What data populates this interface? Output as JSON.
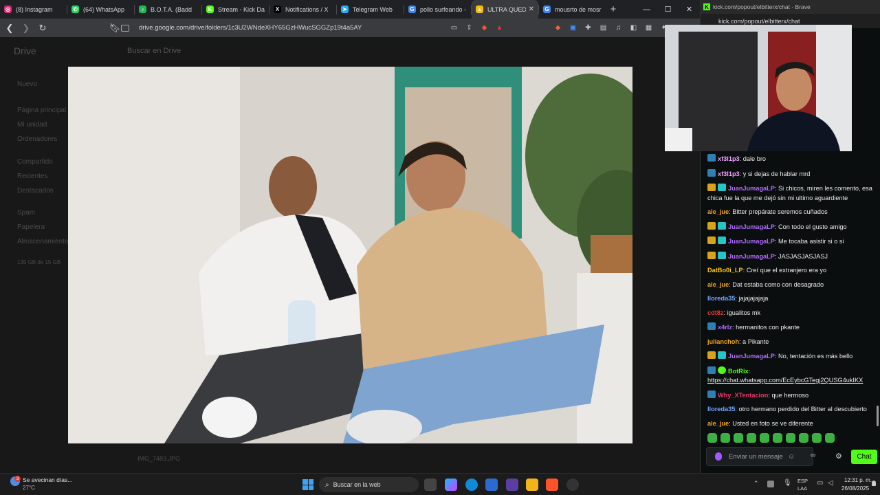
{
  "browser": {
    "tabs": [
      {
        "label": "(8) Instagram",
        "color": "#d62976",
        "glyph": "◎"
      },
      {
        "label": "(64) WhatsApp",
        "color": "#25d366",
        "glyph": "✆"
      },
      {
        "label": "B.O.T.A. (Badd",
        "color": "#1db954",
        "glyph": "♪"
      },
      {
        "label": "Stream - Kick Das",
        "color": "#53fc18",
        "glyph": "K"
      },
      {
        "label": "Notifications / X",
        "color": "#000000",
        "glyph": "X"
      },
      {
        "label": "Telegram Web",
        "color": "#2aabee",
        "glyph": "➤"
      },
      {
        "label": "pollo surfeando -",
        "color": "#4285f4",
        "glyph": "G"
      },
      {
        "label": "ULTRA QUED",
        "color": "#fbbc04",
        "glyph": "▲"
      },
      {
        "label": "mousrto de mosr",
        "color": "#4285f4",
        "glyph": "G"
      }
    ],
    "url": "drive.google.com/drive/folders/1c3U2WNdeXHY65GzHWucSGGZp19t4a5AY"
  },
  "drive": {
    "app_name": "Drive",
    "search_placeholder": "Buscar en Drive",
    "new_button": "Nuevo",
    "sidebar": [
      "Página principal",
      "Mi unidad",
      "Ordenadores",
      "Compartido",
      "Recientes",
      "Destacados",
      "Spam",
      "Papelera",
      "Almacenamiento"
    ],
    "storage": "135 GB de 15 GB",
    "file_row": "IMG_7483.JPG"
  },
  "kick": {
    "window_title": "kick.com/popout/elbitterx/chat - Brave",
    "url": "kick.com/popout/elbitterx/chat",
    "messages": [
      {
        "user": "xf3l1p3",
        "color": "#f2a4ff",
        "badges": [
          "kick"
        ],
        "text": "dale bro"
      },
      {
        "user": "xf3l1p3",
        "color": "#f2a4ff",
        "badges": [
          "kick"
        ],
        "text": "y si dejas de hablar mrd"
      },
      {
        "user": "JuanJumagaLP",
        "color": "#b36bff",
        "badges": [
          "crown",
          "sub"
        ],
        "text": "Si chicos, miren les comento, esa chica fue la que me dejó sin mi ultimo aguardiente"
      },
      {
        "user": "ale_jue",
        "color": "#f5a623",
        "badges": [],
        "text": "Bitter prepárate seremos cuñados"
      },
      {
        "user": "JuanJumagaLP",
        "color": "#b36bff",
        "badges": [
          "crown",
          "sub"
        ],
        "text": "Con todo el gusto amigo"
      },
      {
        "user": "JuanJumagaLP",
        "color": "#b36bff",
        "badges": [
          "crown",
          "sub"
        ],
        "text": "Me tocaba asistir si o si"
      },
      {
        "user": "JuanJumagaLP",
        "color": "#b36bff",
        "badges": [
          "crown",
          "sub"
        ],
        "text": "JASJASJASJASJ"
      },
      {
        "user": "DatBo0i_LP",
        "color": "#f5c518",
        "badges": [],
        "text": "Creí que el extranjero era yo"
      },
      {
        "user": "ale_jue",
        "color": "#f5a623",
        "badges": [],
        "text": "Dat estaba como con desagrado"
      },
      {
        "user": "lloreda35",
        "color": "#6fa8ff",
        "badges": [],
        "text": "jajajajajaja"
      },
      {
        "user": "cdt8z",
        "color": "#e03a3a",
        "badges": [],
        "text": "igualitos mk"
      },
      {
        "user": "x4rlz",
        "color": "#b36bff",
        "badges": [
          "kick"
        ],
        "text": "hermanitos con pkante"
      },
      {
        "user": "julianchoh",
        "color": "#f5a623",
        "badges": [],
        "text": "a Pikante"
      },
      {
        "user": "JuanJumagaLP",
        "color": "#b36bff",
        "badges": [
          "crown",
          "sub"
        ],
        "text": "No, tentación es más bello"
      },
      {
        "user": "BotRix",
        "color": "#53fc18",
        "badges": [
          "kick",
          "bot"
        ],
        "text": "",
        "link": "https://chat.whatsapp.com/EcEybcGTegj2QUSG4ukIKX"
      },
      {
        "user": "Why_XTentacion",
        "color": "#e83a6b",
        "badges": [
          "kick"
        ],
        "text": "que hermoso"
      },
      {
        "user": "lloreda35",
        "color": "#6fa8ff",
        "badges": [],
        "text": "otro hermano perdido del Bitter al descubierto"
      },
      {
        "user": "ale_jue",
        "color": "#f5a623",
        "badges": [],
        "text": "Usted en foto se ve diferente"
      }
    ],
    "input_placeholder": "Enviar un mensaje",
    "chat_button": "Chat"
  },
  "taskbar": {
    "weather_text": "Se avecinan días...",
    "temperature": "27°C",
    "notif_count": "3",
    "search_placeholder": "Buscar en la web",
    "lang_primary": "ESP",
    "lang_secondary": "LAA",
    "time": "12:31 p. m.",
    "date": "26/08/2025"
  }
}
